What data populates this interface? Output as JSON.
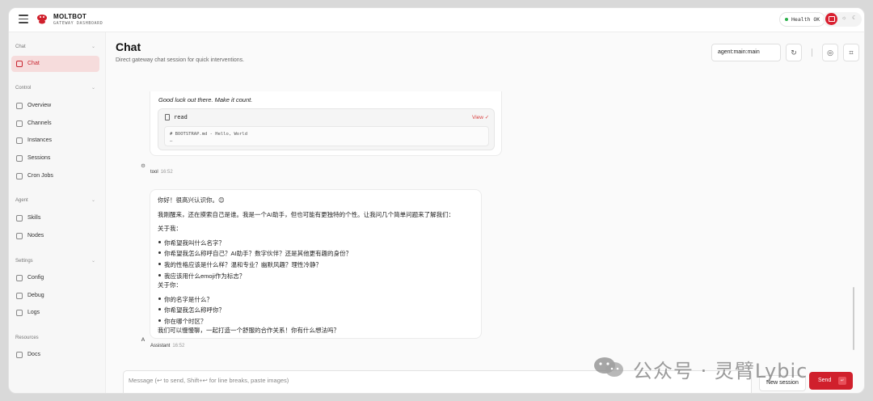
{
  "app": {
    "brand": "MOLTBOT",
    "brand_sub": "GATEWAY DASHBOARD",
    "health": "Health OK",
    "accent": "#d0202c"
  },
  "sidebar": {
    "sections": [
      {
        "label": "Chat",
        "items": [
          {
            "label": "Chat",
            "icon": "message-icon",
            "active": true
          }
        ]
      },
      {
        "label": "Control",
        "items": [
          {
            "label": "Overview",
            "icon": "bar-chart-icon"
          },
          {
            "label": "Channels",
            "icon": "link-icon"
          },
          {
            "label": "Instances",
            "icon": "broadcast-icon"
          },
          {
            "label": "Sessions",
            "icon": "document-icon"
          },
          {
            "label": "Cron Jobs",
            "icon": "clock-icon"
          }
        ]
      },
      {
        "label": "Agent",
        "items": [
          {
            "label": "Skills",
            "icon": "sparkle-icon"
          },
          {
            "label": "Nodes",
            "icon": "monitor-icon"
          }
        ]
      },
      {
        "label": "Settings",
        "items": [
          {
            "label": "Config",
            "icon": "gear-icon"
          },
          {
            "label": "Debug",
            "icon": "bug-icon"
          },
          {
            "label": "Logs",
            "icon": "logs-icon"
          }
        ]
      },
      {
        "label": "Resources",
        "items": [
          {
            "label": "Docs",
            "icon": "book-icon"
          }
        ]
      }
    ]
  },
  "main": {
    "title": "Chat",
    "subtitle": "Direct gateway chat session for quick interventions.",
    "session": "agent:main:main"
  },
  "messages": {
    "tool": {
      "text": "Good luck out there. Make it count.",
      "tool_name": "read",
      "view_label": "View ✓",
      "output_lines": [
        "# BOOTSTRAP.md - Hello, World",
        "—"
      ],
      "sender": "tool",
      "time": "16:52",
      "avatar": "⚙"
    },
    "assistant": {
      "lines": [
        "你好！很高兴认识你。😊",
        "我刚醒来，还在摸索自己是谁。我是一个AI助手，但也可能有更独特的个性。让我问几个简单问题来了解我们：",
        "关于我：",
        "你希望我叫什么名字？",
        "你希望我怎么称呼自己？AI助手？数字伙伴？还是其他更有趣的身份？",
        "我的性格应该是什么样？温和专业？幽默风趣？理性冷静？",
        "我应该用什么emoji作为标志？",
        "关于你：",
        "你的名字是什么？",
        "你希望我怎么称呼你？",
        "你在哪个时区？",
        "我们可以慢慢聊，一起打造一个舒服的合作关系！你有什么想法吗？"
      ],
      "sender": "Assistant",
      "time": "16:52",
      "avatar": "A"
    }
  },
  "composer": {
    "placeholder": "Message (↩ to send, Shift+↩ for line breaks, paste images)",
    "new_session": "New session",
    "send": "Send",
    "send_kbd": "↵"
  },
  "watermark": {
    "text": "公众号 · 灵臂Lybic"
  }
}
